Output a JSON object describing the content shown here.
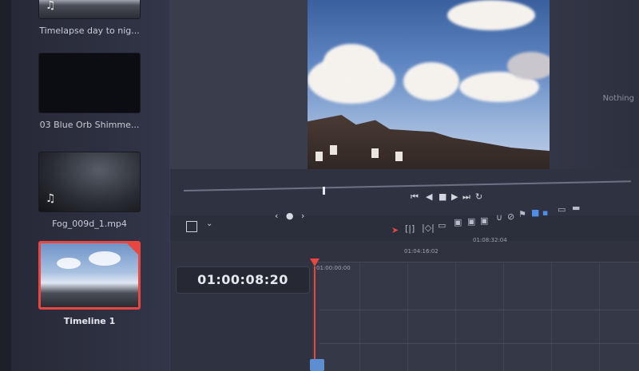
{
  "media_pool": {
    "clips": [
      {
        "label": "Timelapse day to nig..."
      },
      {
        "label": "03 Blue Orb Shimme..."
      },
      {
        "label": "Fog_009d_1.mp4"
      },
      {
        "label": "Timeline 1"
      }
    ]
  },
  "viewer": {
    "side_label": "Nothing"
  },
  "transport": {
    "nav_label": "‹ ● ›"
  },
  "timeline": {
    "timecode": "01:00:08:20",
    "ruler": [
      "01:00:00:00",
      "01:04:16:02",
      "01:08:32:04"
    ]
  },
  "colors": {
    "accent_red": "#e8463f",
    "accent_blue": "#4f8de8",
    "panel": "#2f3240"
  },
  "icons": {
    "music": "♫",
    "prev": "⏮",
    "back": "◀",
    "stop": "■",
    "play": "▶",
    "next": "⏭",
    "loop": "↻",
    "pointer": "➤",
    "chevron": "⌄"
  }
}
